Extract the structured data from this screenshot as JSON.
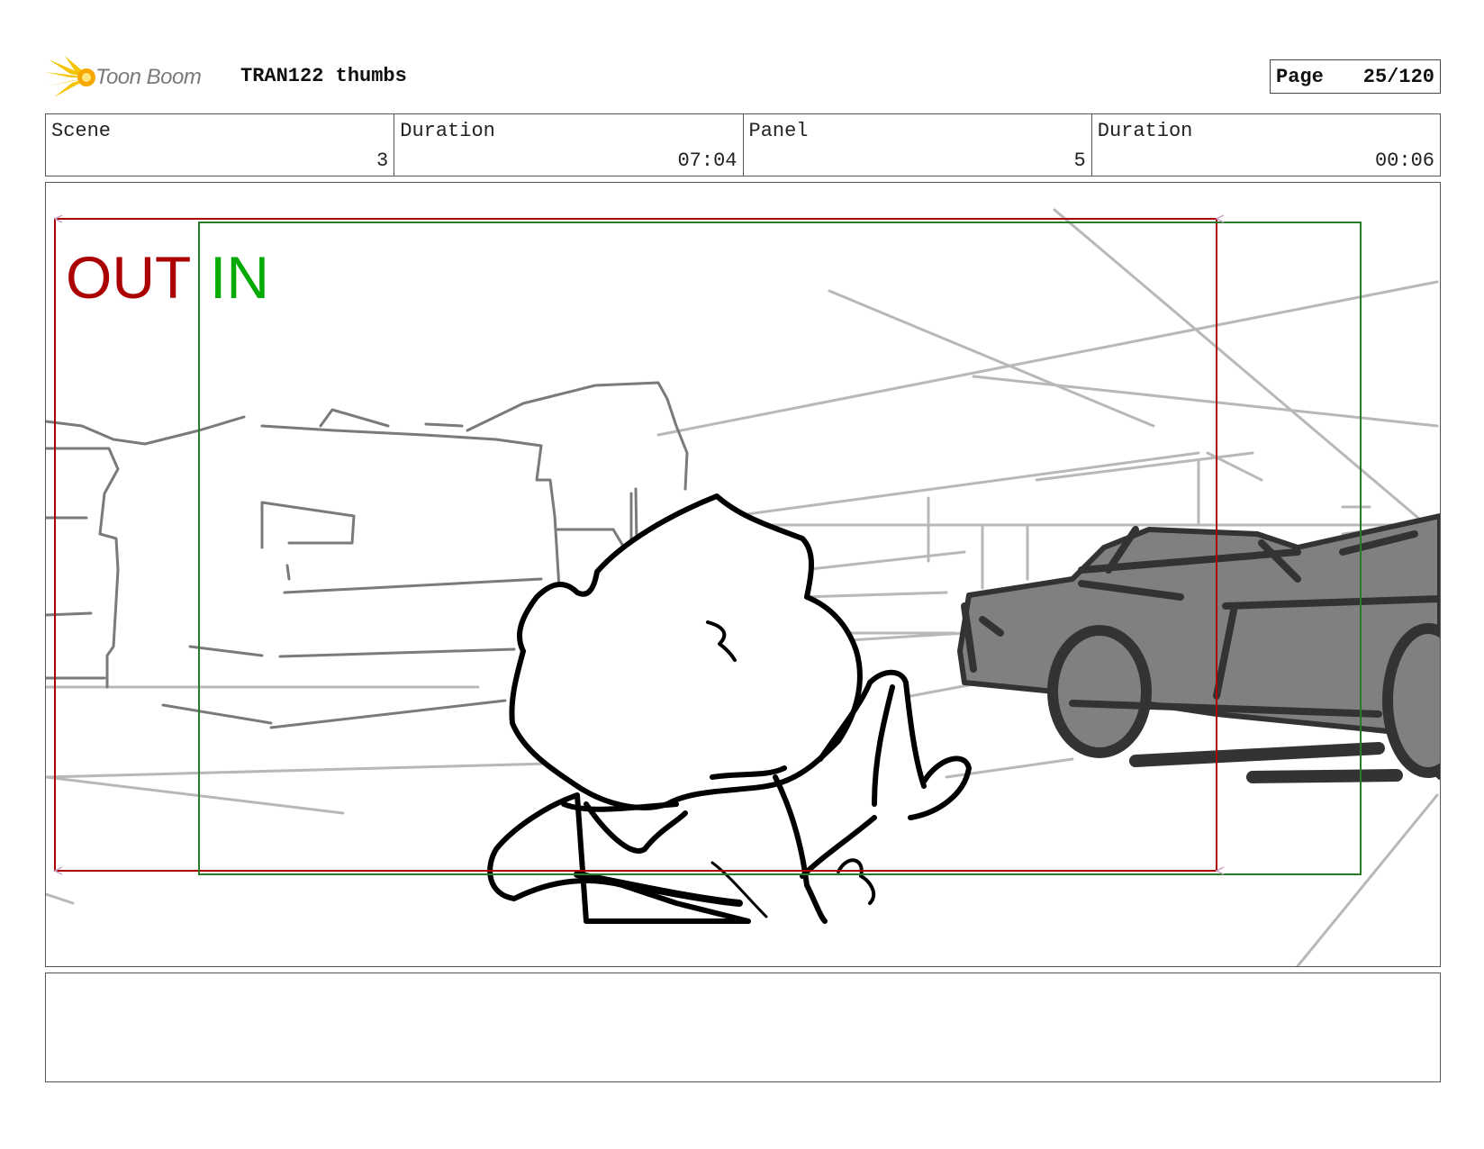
{
  "header": {
    "logo_text": "Toon Boom",
    "project_title": "TRAN122 thumbs",
    "page_label": "Page",
    "page_number": "25/120"
  },
  "info": {
    "scene_label": "Scene",
    "scene_value": "3",
    "scene_duration_label": "Duration",
    "scene_duration_value": "07:04",
    "panel_label": "Panel",
    "panel_value": "5",
    "panel_duration_label": "Duration",
    "panel_duration_value": "00:06"
  },
  "panel": {
    "out_label": "OUT",
    "in_label": "IN",
    "out_color": "#aa0000",
    "in_color": "#00aa00"
  },
  "notes": {
    "text": ""
  }
}
